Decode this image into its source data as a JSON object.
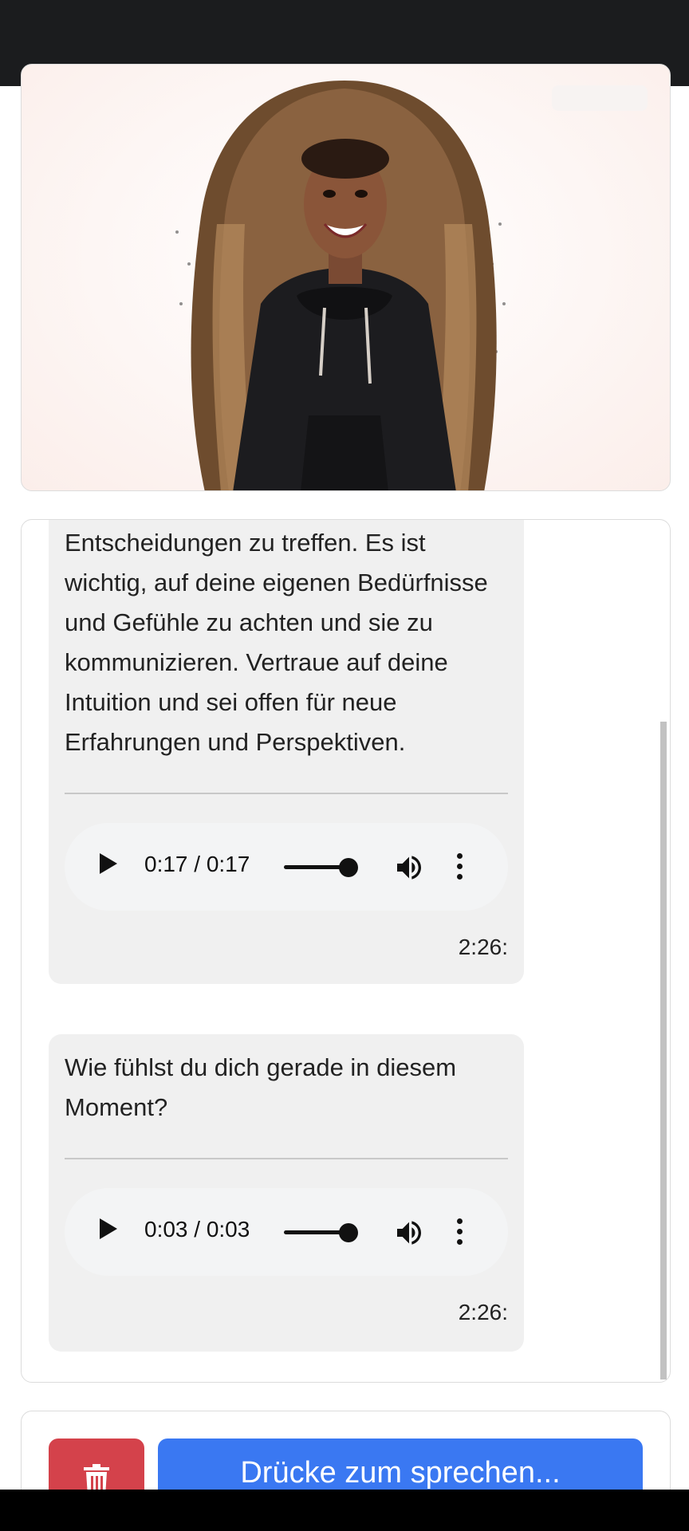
{
  "chat": {
    "messages": [
      {
        "text": "Entscheidungen zu treffen. Es ist wichtig, auf deine eigenen Bedürfnisse und Gefühle zu achten und sie zu kommunizieren. Vertraue auf deine Intuition und sei offen für neue Erfahrungen und Perspektiven.",
        "audio_time": "0:17 / 0:17",
        "audio_progress": 1.0,
        "timestamp": "2:26:"
      },
      {
        "text": "Wie fühlst du dich gerade in diesem Moment?",
        "audio_time": "0:03 / 0:03",
        "audio_progress": 1.0,
        "timestamp": "2:26:"
      }
    ]
  },
  "controls": {
    "delete_icon": "trash-icon",
    "talk_label": "Drücke zum sprechen..."
  },
  "colors": {
    "delete": "#d4424b",
    "talk": "#3a78f2",
    "bubble": "#f0f0f0"
  }
}
